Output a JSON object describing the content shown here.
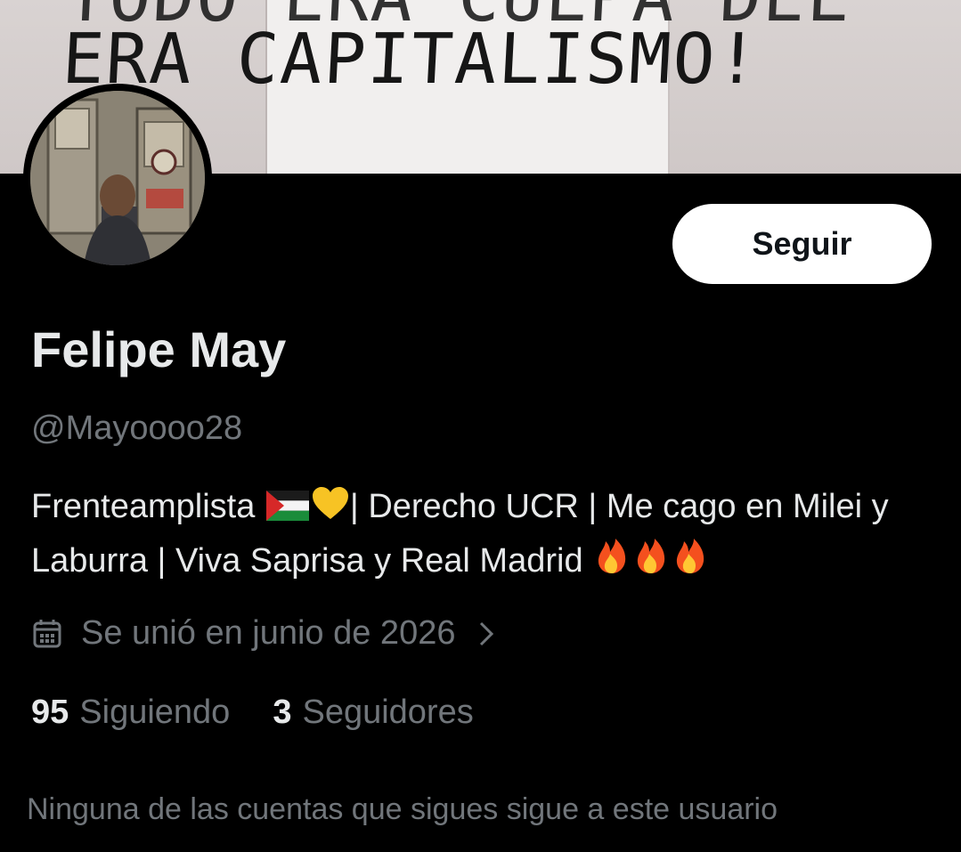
{
  "banner": {
    "text_top": "TODO ERA CULPA DEL",
    "text_main": "ERA  CAPITALISMO!"
  },
  "profile": {
    "follow_label": "Seguir",
    "display_name": "Felipe May",
    "handle": "@Mayoooo28",
    "bio_part1": "Frenteamplista ",
    "bio_part2": "| Derecho UCR | Me cago en Milei y Laburra | Viva Saprisa y Real Madrid ",
    "joined": "Se unió en junio de 2026",
    "following_count": "95",
    "following_label": "Siguiendo",
    "followers_count": "3",
    "followers_label": "Seguidores",
    "mutuals_note": "Ninguna de las cuentas que sigues sigue a este usuario"
  },
  "colors": {
    "background": "#000000",
    "primary_text": "#e7e9ea",
    "secondary_text": "#71767b",
    "follow_button_bg": "#ffffff"
  },
  "icons": [
    "palestine-flag-icon",
    "yellow-heart-icon",
    "fire-icon",
    "calendar-icon",
    "chevron-right-icon"
  ]
}
